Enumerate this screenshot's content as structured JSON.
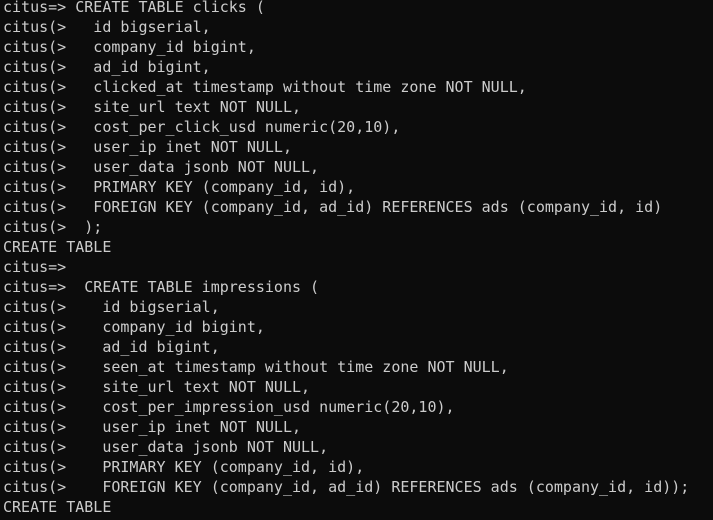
{
  "terminal": {
    "lines": [
      "citus=> CREATE TABLE clicks (",
      "citus(>   id bigserial,",
      "citus(>   company_id bigint,",
      "citus(>   ad_id bigint,",
      "citus(>   clicked_at timestamp without time zone NOT NULL,",
      "citus(>   site_url text NOT NULL,",
      "citus(>   cost_per_click_usd numeric(20,10),",
      "citus(>   user_ip inet NOT NULL,",
      "citus(>   user_data jsonb NOT NULL,",
      "citus(>   PRIMARY KEY (company_id, id),",
      "citus(>   FOREIGN KEY (company_id, ad_id) REFERENCES ads (company_id, id)",
      "citus(>  );",
      "CREATE TABLE",
      "citus=>",
      "citus=>  CREATE TABLE impressions (",
      "citus(>    id bigserial,",
      "citus(>    company_id bigint,",
      "citus(>    ad_id bigint,",
      "citus(>    seen_at timestamp without time zone NOT NULL,",
      "citus(>    site_url text NOT NULL,",
      "citus(>    cost_per_impression_usd numeric(20,10),",
      "citus(>    user_ip inet NOT NULL,",
      "citus(>    user_data jsonb NOT NULL,",
      "citus(>    PRIMARY KEY (company_id, id),",
      "citus(>    FOREIGN KEY (company_id, ad_id) REFERENCES ads (company_id, id));",
      "CREATE TABLE"
    ]
  }
}
